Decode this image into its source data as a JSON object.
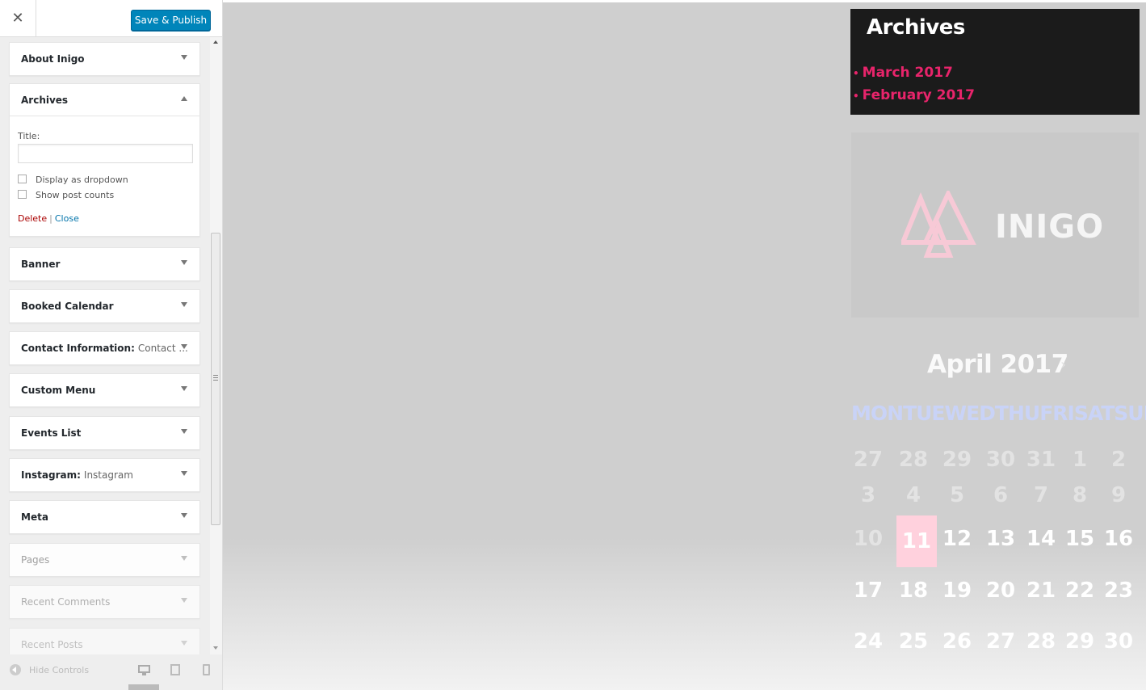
{
  "header": {
    "close_label": "✕",
    "publish_label": "Save & Publish"
  },
  "widgets": [
    {
      "title": "About Inigo",
      "subtitle": ""
    },
    {
      "title": "Archives",
      "subtitle": ""
    },
    {
      "title": "Banner",
      "subtitle": ""
    },
    {
      "title": "Booked Calendar",
      "subtitle": ""
    },
    {
      "title": "Contact Information:",
      "subtitle": "Contact ..."
    },
    {
      "title": "Custom Menu",
      "subtitle": ""
    },
    {
      "title": "Events List",
      "subtitle": ""
    },
    {
      "title": "Instagram:",
      "subtitle": "Instagram"
    },
    {
      "title": "Meta",
      "subtitle": ""
    },
    {
      "title": "Pages",
      "subtitle": ""
    },
    {
      "title": "Recent Comments",
      "subtitle": ""
    },
    {
      "title": "Recent Posts",
      "subtitle": ""
    }
  ],
  "archives_form": {
    "title_label": "Title:",
    "title_value": "",
    "dropdown_label": "Display as dropdown",
    "dropdown_checked": false,
    "counts_label": "Show post counts",
    "counts_checked": false,
    "delete_label": "Delete",
    "separator": "|",
    "close_label": "Close"
  },
  "footer": {
    "hide_controls_label": "Hide Controls",
    "devices": [
      "desktop-icon",
      "tablet-icon",
      "mobile-icon"
    ],
    "active_device": "desktop"
  },
  "preview": {
    "archives": {
      "title": "Archives",
      "items": [
        "March 2017",
        "February 2017"
      ],
      "bullet": "•"
    },
    "logo": {
      "text": "INIGO"
    },
    "calendar": {
      "month": "April 2017",
      "next_label": "›",
      "weekdays": [
        "MON",
        "TUE",
        "WED",
        "THU",
        "FRI",
        "SAT",
        "SUN"
      ],
      "weeks": [
        [
          "27",
          "28",
          "29",
          "30",
          "31",
          "1",
          "2"
        ],
        [
          "3",
          "4",
          "5",
          "6",
          "7",
          "8",
          "9"
        ],
        [
          "10",
          "11",
          "12",
          "13",
          "14",
          "15",
          "16"
        ],
        [
          "17",
          "18",
          "19",
          "20",
          "21",
          "22",
          "23"
        ],
        [
          "24",
          "25",
          "26",
          "27",
          "28",
          "29",
          "30"
        ]
      ],
      "today": "11"
    }
  },
  "colors": {
    "primary_button": "#0085ba",
    "archive_link": "#e8246b",
    "today_highlight": "#ffd1dd",
    "weekday_text": "#c9d3f7"
  }
}
